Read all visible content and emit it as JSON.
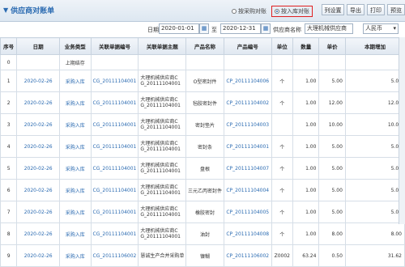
{
  "header": {
    "title": "供应商对账单",
    "radio_supplier": "按采购对账",
    "radio_storage": "按入库对账",
    "btn_columns": "列设置",
    "btn_export": "导出",
    "btn_print": "打印",
    "btn_preview": "预览"
  },
  "filter": {
    "date_label": "日期",
    "date_from": "2020-01-01",
    "to": "至",
    "date_to": "2020-12-31",
    "supplier_label": "供应商名称",
    "supplier_value": "大理机械供应商",
    "currency_value": "人民币"
  },
  "table": {
    "columns": [
      "序号",
      "日期",
      "业务类型",
      "关联单据编号",
      "关联单据主题",
      "产品名称",
      "产品编号",
      "单位",
      "数量",
      "单价",
      "本期增加"
    ],
    "first_row": [
      "0",
      "",
      "上期结存",
      "",
      "",
      "",
      "",
      "",
      "",
      "",
      ""
    ],
    "rows": [
      [
        "1",
        "2020-02-26",
        "采购入库",
        "CG_20111104001",
        "大理机械供应商C G_20111104001",
        "O型密封件",
        "CP_20111104006",
        "个",
        "1.00",
        "5.00",
        "5.00"
      ],
      [
        "2",
        "2020-02-26",
        "采购入库",
        "CG_20111104001",
        "大理机械供应商C G_20111104001",
        "毡胶密封件",
        "CP_20111104002",
        "个",
        "1.00",
        "12.00",
        "12.00"
      ],
      [
        "3",
        "2020-02-26",
        "采购入库",
        "CG_20111104001",
        "大理机械供应商C G_20111104001",
        "密封垫片",
        "CP_20111104003",
        "",
        "1.00",
        "10.00",
        "10.00"
      ],
      [
        "4",
        "2020-02-26",
        "采购入库",
        "CG_20111104001",
        "大理机械供应商C G_20111104001",
        "密封条",
        "CP_20111104001",
        "个",
        "1.00",
        "5.00",
        "5.00"
      ],
      [
        "5",
        "2020-02-26",
        "采购入库",
        "CG_20111104001",
        "大理机械供应商C G_20111104001",
        "盘根",
        "CP_20111104007",
        "个",
        "1.00",
        "5.00",
        "5.00"
      ],
      [
        "6",
        "2020-02-26",
        "采购入库",
        "CG_20111104001",
        "大理机械供应商C G_20111104001",
        "三元乙丙密封件",
        "CP_20111104004",
        "个",
        "1.00",
        "5.00",
        "5.00"
      ],
      [
        "7",
        "2020-02-26",
        "采购入库",
        "CG_20111104001",
        "大理机械供应商C G_20111104001",
        "橡胶密封",
        "CP_20111104005",
        "个",
        "1.00",
        "5.00",
        "5.00"
      ],
      [
        "8",
        "2020-02-26",
        "采购入库",
        "CG_20111104001",
        "大理机械供应商C G_20111104001",
        "油封",
        "CP_20111104008",
        "个",
        "1.00",
        "8.00",
        "8.00"
      ],
      [
        "9",
        "2020-02-26",
        "采购入库",
        "CG_20111106002",
        "慧诚生产合并采购单",
        "镍糊",
        "CP_20111106002",
        "Z0002",
        "63.24",
        "0.50",
        "31.62"
      ]
    ]
  },
  "colors": {
    "accent": "#2a6ab1",
    "highlight": "#e02020"
  }
}
